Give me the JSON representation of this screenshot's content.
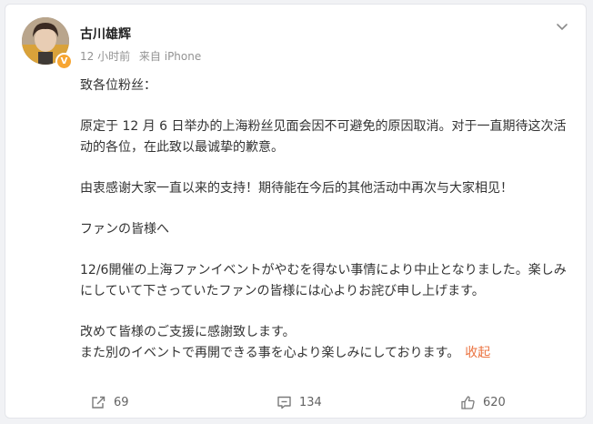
{
  "post": {
    "author": "古川雄辉",
    "time": "12 小时前",
    "source": "来自 iPhone",
    "paragraphs": [
      "致各位粉丝：",
      "原定于 12 月 6 日举办的上海粉丝见面会因不可避免的原因取消。对于一直期待这次活动的各位，在此致以最诚挚的歉意。",
      "由衷感谢大家一直以来的支持！期待能在今后的其他活动中再次与大家相见！",
      "ファンの皆様へ",
      "12/6開催の上海ファンイベントがやむを得ない事情により中止となりました。楽しみにしていて下さっていたファンの皆様には心よりお詫び申し上げます。",
      "改めて皆様のご支援に感謝致します。",
      "また別のイベントで再開できる事を心より楽しみにしております。"
    ],
    "collapse_label": "收起"
  },
  "actions": {
    "repost_count": "69",
    "comment_count": "134",
    "like_count": "620"
  },
  "icons": {
    "verified": "verified-badge-icon",
    "more": "chevron-down-icon",
    "repost": "repost-icon",
    "comment": "comment-icon",
    "like": "thumbs-up-icon"
  },
  "colors": {
    "accent": "#eb7340",
    "badge": "#f7a531"
  }
}
